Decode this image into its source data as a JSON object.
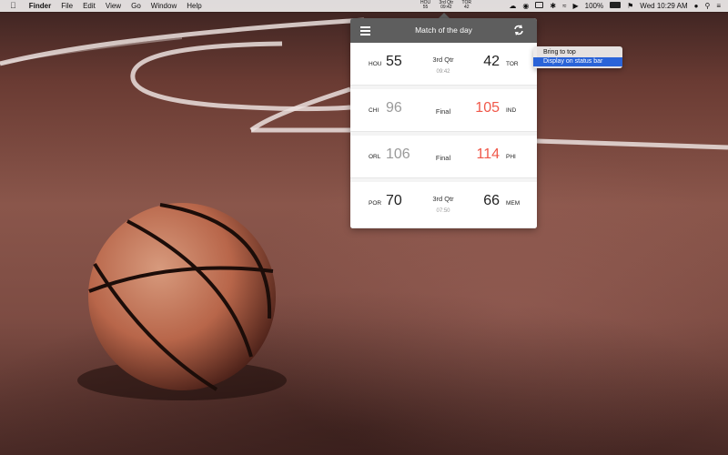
{
  "menubar": {
    "apple_icon": "apple-logo",
    "app_name": "Finder",
    "items": [
      "File",
      "Edit",
      "View",
      "Go",
      "Window",
      "Help"
    ],
    "status_widget": {
      "home_team": "HOU",
      "home_score": "55",
      "period": "3rd Qtr",
      "clock": "09:42",
      "away_team": "TOR",
      "away_score": "42"
    },
    "battery": "100%",
    "datetime": "Wed 10:29 AM"
  },
  "popover": {
    "title": "Match of the day",
    "games": [
      {
        "home_team": "HOU",
        "home_score": "55",
        "status": "3rd Qtr",
        "clock": "09:42",
        "away_score": "42",
        "away_team": "TOR",
        "home_color": "#222222",
        "away_color": "#222222"
      },
      {
        "home_team": "CHI",
        "home_score": "96",
        "status": "Final",
        "clock": "",
        "away_score": "105",
        "away_team": "IND",
        "home_color": "#9a9a9a",
        "away_color": "#f0584a"
      },
      {
        "home_team": "ORL",
        "home_score": "106",
        "status": "Final",
        "clock": "",
        "away_score": "114",
        "away_team": "PHI",
        "home_color": "#9a9a9a",
        "away_color": "#f0584a"
      },
      {
        "home_team": "POR",
        "home_score": "70",
        "status": "3rd Qtr",
        "clock": "07:50",
        "away_score": "66",
        "away_team": "MEM",
        "home_color": "#222222",
        "away_color": "#222222"
      }
    ]
  },
  "context_menu": {
    "items": [
      "Bring to top",
      "Display on status bar"
    ],
    "selected_index": 1
  },
  "colors": {
    "header_bg": "#5e5e5e",
    "selection": "#2a63d8",
    "winner": "#f0584a",
    "loser": "#9a9a9a"
  }
}
